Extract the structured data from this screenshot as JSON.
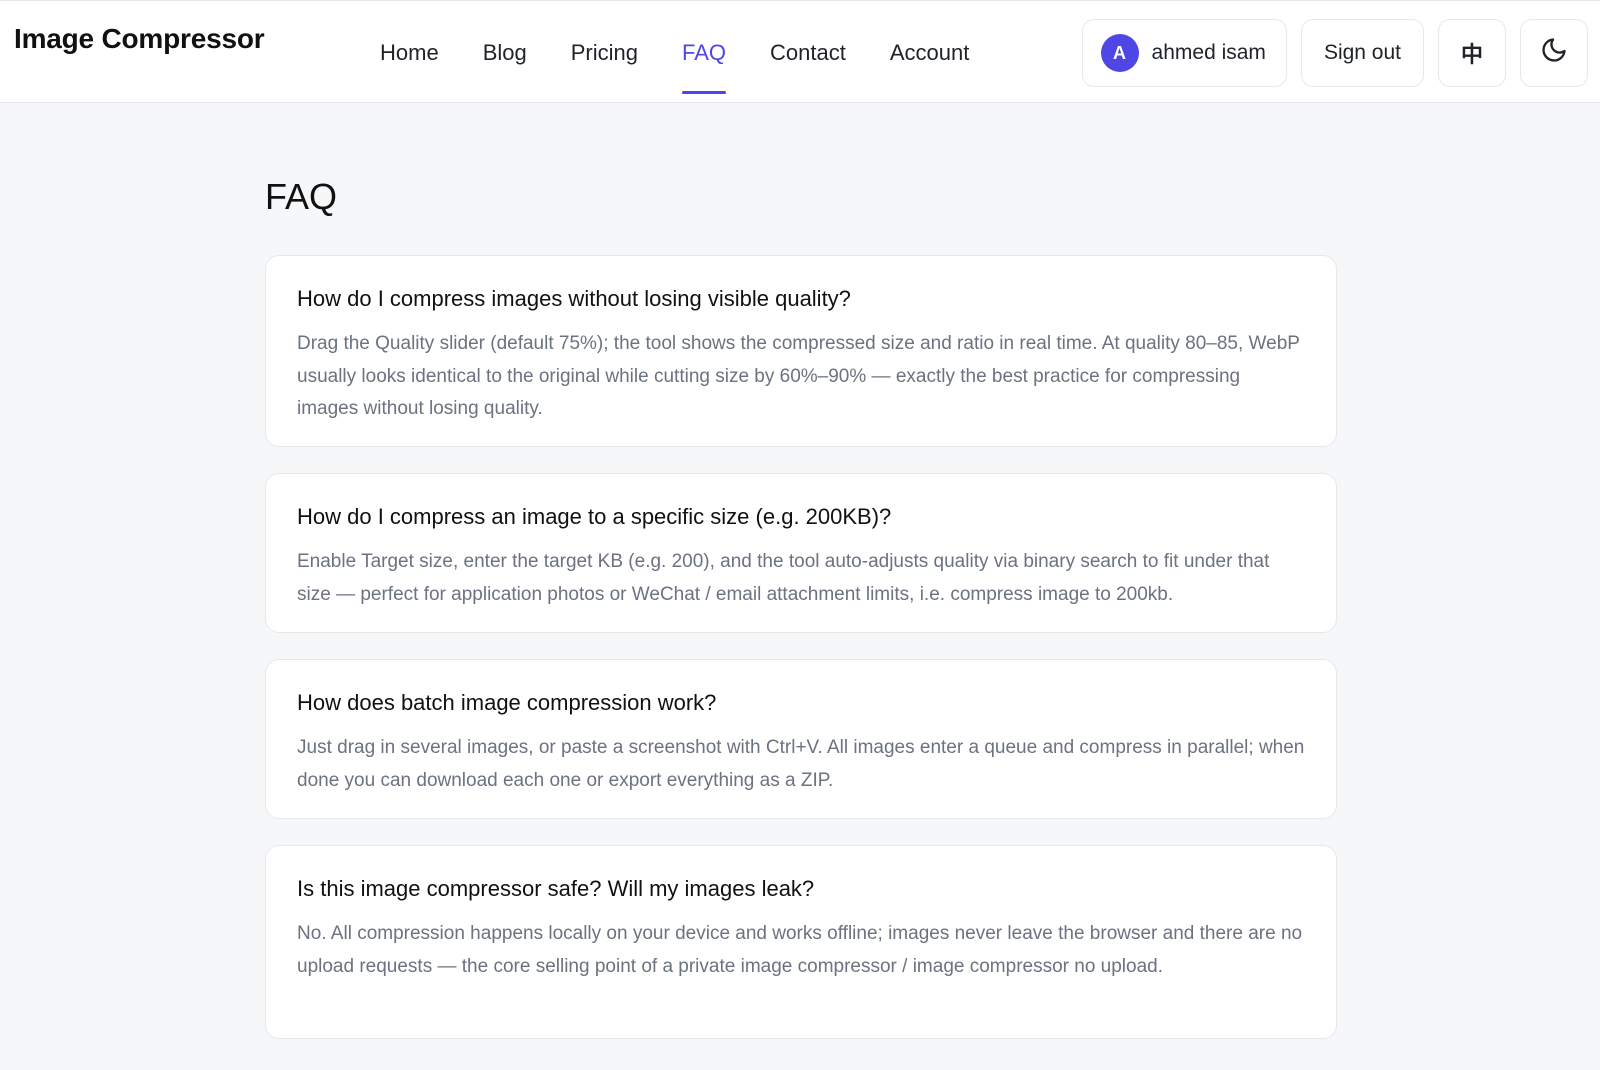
{
  "header": {
    "brand": "Image Compressor",
    "nav": [
      {
        "label": "Home",
        "active": false
      },
      {
        "label": "Blog",
        "active": false
      },
      {
        "label": "Pricing",
        "active": false
      },
      {
        "label": "FAQ",
        "active": true
      },
      {
        "label": "Contact",
        "active": false
      },
      {
        "label": "Account",
        "active": false
      }
    ],
    "user": {
      "avatar_initial": "A",
      "name": "ahmed isam"
    },
    "signout_label": "Sign out",
    "lang_label": "中",
    "theme_icon": "moon-icon",
    "accent_color": "#4f46e5"
  },
  "main": {
    "title": "FAQ",
    "faqs": [
      {
        "question": "How do I compress images without losing visible quality?",
        "answer": "Drag the Quality slider (default 75%); the tool shows the compressed size and ratio in real time. At quality 80–85, WebP usually looks identical to the original while cutting size by 60%–90% — exactly the best practice for compressing images without losing quality."
      },
      {
        "question": "How do I compress an image to a specific size (e.g. 200KB)?",
        "answer": "Enable Target size, enter the target KB (e.g. 200), and the tool auto-adjusts quality via binary search to fit under that size — perfect for application photos or WeChat / email attachment limits, i.e. compress image to 200kb."
      },
      {
        "question": "How does batch image compression work?",
        "answer": "Just drag in several images, or paste a screenshot with Ctrl+V. All images enter a queue and compress in parallel; when done you can download each one or export everything as a ZIP."
      },
      {
        "question": "Is this image compressor safe? Will my images leak?",
        "answer": "No. All compression happens locally on your device and works offline; images never leave the browser and there are no upload requests — the core selling point of a private image compressor / image compressor no upload."
      }
    ]
  }
}
